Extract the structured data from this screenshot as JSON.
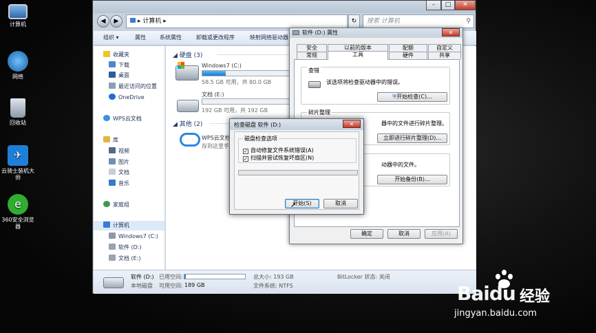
{
  "desktop": {
    "icons": [
      {
        "label": "计算机",
        "icon": "computer-icon"
      },
      {
        "label": "网络",
        "icon": "network-icon"
      },
      {
        "label": "回收站",
        "icon": "recycle-bin-icon"
      },
      {
        "label": "云骑士装机大师",
        "icon": "yunqishi-icon"
      },
      {
        "label": "360安全浏览器",
        "icon": "browser-360-icon"
      }
    ]
  },
  "explorer": {
    "address": "计算机",
    "search_placeholder": "搜索 计算机",
    "toolbar": [
      "组织 ▾",
      "属性",
      "系统属性",
      "卸载或更改程序",
      "映射网络驱动器"
    ],
    "nav": {
      "favorites": "收藏夹",
      "downloads": "下载",
      "desktop": "桌面",
      "recent": "最近访问的位置",
      "onedrive": "OneDrive",
      "wps": "WPS云文档",
      "libraries": "库",
      "videos": "视频",
      "pictures": "图片",
      "documents": "文档",
      "music": "音乐",
      "homegroup": "家庭组",
      "computer": "计算机",
      "drive_c": "Windows7 (C:)",
      "drive_d": "软件 (D:)",
      "drive_e": "文档 (E:)"
    },
    "content": {
      "hdd_group": "硬盘 (3)",
      "drive_c_name": "Windows7 (C:)",
      "drive_c_free": "58.5 GB 可用，共 80.0 GB",
      "drive_c_used_fraction": 0.27,
      "drive_e_name": "文档 (E:)",
      "drive_e_free": "192 GB 可用，共 192 GB",
      "drive_e_used_fraction": 0.0,
      "other_group": "其他 (2)",
      "wps_name": "WPS云文档",
      "wps_desc": "存到这里手"
    },
    "status": {
      "name": "软件 (D:)",
      "used_label": "已用空间:",
      "type": "本地磁盘",
      "free_label": "可用空间:",
      "free_value": "189 GB",
      "total": "总大小: 193 GB",
      "fs": "文件系统: NTFS",
      "bitlocker": "BitLocker 状态: 关闭",
      "used_fraction": 0.02
    }
  },
  "props": {
    "title": "软件 (D:) 属性",
    "tabs_row1": [
      "安全",
      "以前的版本",
      "配额",
      "自定义"
    ],
    "tabs_row2": [
      "常规",
      "工具",
      "硬件",
      "共享"
    ],
    "check_group": "查错",
    "check_desc": "该选项将检查驱动器中的错误。",
    "check_btn": "开始检查(C)...",
    "defrag_group": "碎片整理",
    "defrag_desc": "器中的文件进行碎片整理。",
    "defrag_btn": "立即进行碎片整理(D)...",
    "backup_desc": "动器中的文件。",
    "backup_btn": "开始备份(B)...",
    "ok": "确定",
    "cancel": "取消",
    "apply": "应用(A)"
  },
  "checkdisk": {
    "title": "检查磁盘 软件 (D:)",
    "group": "磁盘检查选项",
    "opt1": "自动修复文件系统错误(A)",
    "opt2": "扫描并尝试恢复坏扇区(N)",
    "start": "开始(S)",
    "cancel": "取消"
  },
  "watermark": {
    "brand": "Baidu",
    "brand_cn": "经验",
    "url": "jingyan.baidu.com"
  }
}
